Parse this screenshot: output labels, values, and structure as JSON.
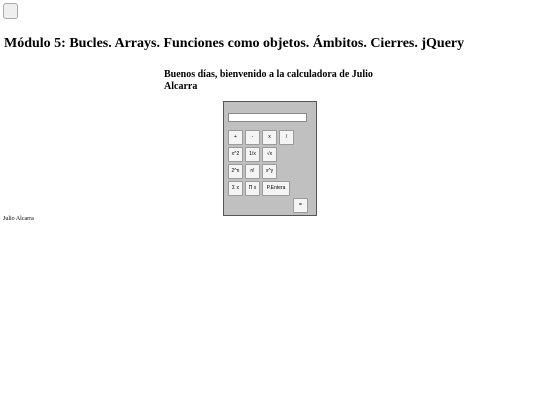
{
  "page": {
    "title": "Módulo 5: Bucles. Arrays. Funciones como objetos. Ámbitos. Cierres. jQuery",
    "greeting": "Buenos días, bienvenido a la calculadora de Julio Alcarra",
    "footer": "Julio Alcarra"
  },
  "calculator": {
    "display_value": "",
    "keys": {
      "add": "+",
      "subtract": "-",
      "multiply": "x",
      "divide": "/",
      "square": "x^2",
      "reciprocal": "1/x",
      "sqrt": "√x",
      "pow2": "2^n",
      "factorial": "n!",
      "power": "x^y",
      "sum": "Σ x",
      "product": "Π x",
      "integer_part": "P.Entera",
      "equals": "="
    }
  }
}
